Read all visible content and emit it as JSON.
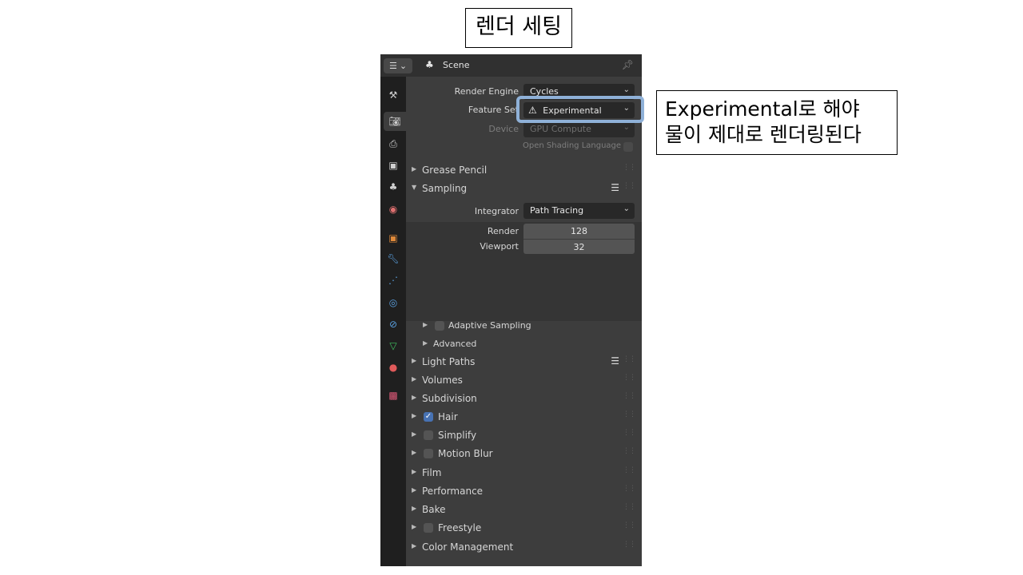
{
  "slide": {
    "title": "렌더 세팅",
    "callout_line1": "Experimental로 해야",
    "callout_line2": "물이 제대로 렌더링된다"
  },
  "header": {
    "editor_icon": "properties-editor-icon",
    "scene_label": "Scene"
  },
  "tabs": [
    {
      "name": "tool-tab",
      "icon": "wrench-screwdriver-icon"
    },
    {
      "name": "render-tab",
      "icon": "camera-back-icon",
      "active": true
    },
    {
      "name": "output-tab",
      "icon": "printer-icon"
    },
    {
      "name": "view-layer-tab",
      "icon": "image-stack-icon"
    },
    {
      "name": "scene-tab",
      "icon": "scene-icon"
    },
    {
      "name": "world-tab",
      "icon": "globe-icon"
    },
    {
      "name": "object-tab",
      "icon": "square-object-icon"
    },
    {
      "name": "modifier-tab",
      "icon": "wrench-icon"
    },
    {
      "name": "particles-tab",
      "icon": "particles-icon"
    },
    {
      "name": "physics-tab",
      "icon": "physics-icon"
    },
    {
      "name": "constraints-tab",
      "icon": "constraint-icon"
    },
    {
      "name": "data-tab",
      "icon": "mesh-data-icon"
    },
    {
      "name": "material-tab",
      "icon": "material-sphere-icon"
    },
    {
      "name": "texture-tab",
      "icon": "checker-texture-icon"
    }
  ],
  "render": {
    "engine_label": "Render Engine",
    "engine_value": "Cycles",
    "feature_set_label": "Feature Set",
    "feature_set_value": "Experimental",
    "device_label": "Device",
    "device_value": "GPU Compute",
    "osl_label": "Open Shading Language"
  },
  "sections": {
    "grease_pencil": "Grease Pencil",
    "sampling": "Sampling",
    "integrator_label": "Integrator",
    "integrator_value": "Path Tracing",
    "render_label": "Render",
    "render_value": "128",
    "viewport_label": "Viewport",
    "viewport_value": "32",
    "adaptive_sampling": "Adaptive Sampling",
    "advanced": "Advanced",
    "light_paths": "Light Paths",
    "volumes": "Volumes",
    "subdivision": "Subdivision",
    "hair": "Hair",
    "simplify": "Simplify",
    "motion_blur": "Motion Blur",
    "film": "Film",
    "performance": "Performance",
    "bake": "Bake",
    "freestyle": "Freestyle",
    "color_management": "Color Management"
  },
  "colors": {
    "accent": "#4772b3",
    "highlight": "#8fb1d8",
    "panel_bg": "#3d3d3d"
  }
}
